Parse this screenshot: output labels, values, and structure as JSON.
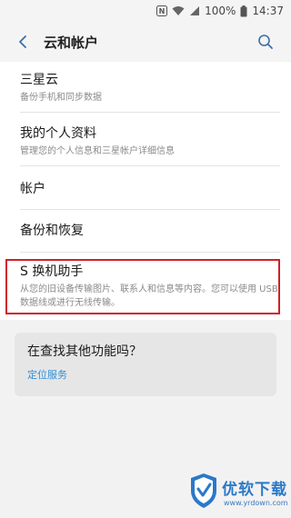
{
  "status_bar": {
    "battery": "100%",
    "time": "14:37"
  },
  "header": {
    "title": "云和帐户"
  },
  "list": {
    "items": [
      {
        "title": "三星云",
        "subtitle": "备份手机和同步数据"
      },
      {
        "title": "我的个人资料",
        "subtitle": "管理您的个人信息和三星帐户详细信息"
      },
      {
        "title": "帐户",
        "subtitle": ""
      },
      {
        "title": "备份和恢复",
        "subtitle": ""
      },
      {
        "title": "S 换机助手",
        "subtitle": "从您的旧设备传输图片、联系人和信息等内容。您可以使用 USB 数据线或进行无线传输。"
      }
    ]
  },
  "promo": {
    "title": "在查找其他功能吗？",
    "link": "定位服务"
  },
  "watermark": {
    "brand": "优软下载",
    "url": "www.yrdown.com"
  },
  "colors": {
    "accent": "#2f8fd8",
    "highlight": "#d0202a",
    "background": "#f2f2f2"
  }
}
